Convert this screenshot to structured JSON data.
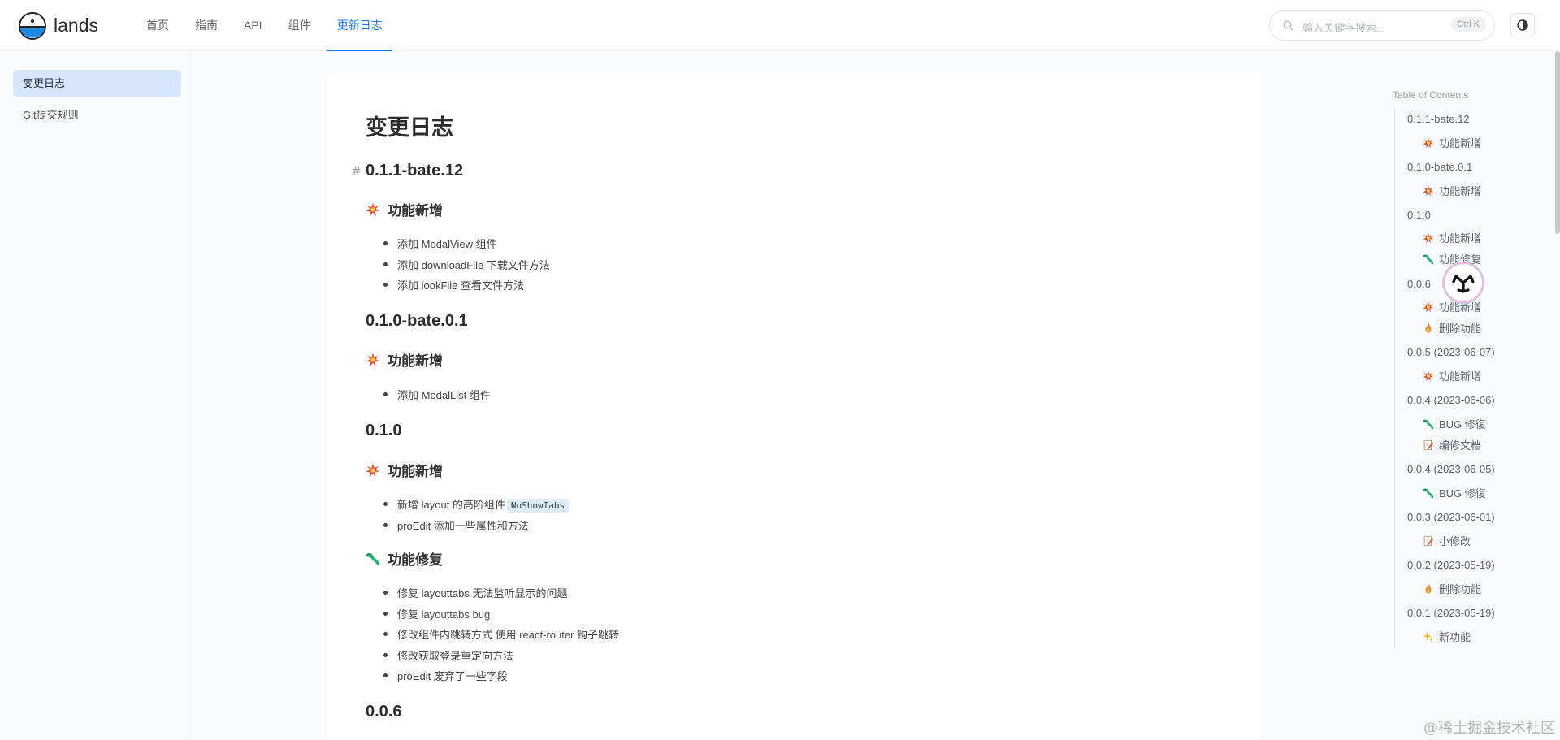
{
  "header": {
    "brand": "lands",
    "nav": [
      "首页",
      "指南",
      "API",
      "组件",
      "更新日志"
    ],
    "active_nav": "更新日志",
    "search": {
      "placeholder": "输入关键字搜索...",
      "shortcut": "Ctrl K"
    },
    "accent": "#1677ff"
  },
  "sidebar": {
    "items": [
      {
        "label": "变更日志",
        "active": true
      },
      {
        "label": "Git提交规则",
        "active": false
      }
    ]
  },
  "doc": {
    "title": "变更日志",
    "anchor": "#",
    "sections": [
      {
        "version": "0.1.1-bate.12",
        "groups": [
          {
            "emoji": "boom",
            "title": "功能新增",
            "items": [
              "添加 ModalView 组件",
              "添加 downloadFile 下载文件方法",
              "添加 lookFile 查看文件方法"
            ]
          }
        ]
      },
      {
        "version": "0.1.0-bate.0.1",
        "groups": [
          {
            "emoji": "boom",
            "title": "功能新增",
            "items": [
              "添加 ModalList 组件"
            ]
          }
        ]
      },
      {
        "version": "0.1.0",
        "groups": [
          {
            "emoji": "boom",
            "title": "功能新增",
            "items": [
              "新增 layout 的高阶组件",
              "proEdit 添加一些属性和方法"
            ],
            "code": "NoShowTabs"
          },
          {
            "emoji": "bug",
            "title": "功能修复",
            "items": [
              "修复 layouttabs 无法监听显示的问题",
              "修复 layouttabs bug",
              "修改组件内跳转方式 使用 react-router 钩子跳转",
              "修改获取登录重定向方法",
              "proEdit 废弃了一些字段"
            ]
          }
        ]
      },
      {
        "version": "0.0.6",
        "groups": []
      }
    ]
  },
  "toc": {
    "title": "Table of Contents",
    "entries": [
      {
        "version": "0.1.1-bate.12",
        "subs": [
          {
            "emoji": "boom",
            "label": "功能新增"
          }
        ]
      },
      {
        "version": "0.1.0-bate.0.1",
        "subs": [
          {
            "emoji": "boom",
            "label": "功能新增"
          }
        ]
      },
      {
        "version": "0.1.0",
        "subs": [
          {
            "emoji": "boom",
            "label": "功能新增"
          },
          {
            "emoji": "bug",
            "label": "功能修复"
          }
        ]
      },
      {
        "version": "0.0.6",
        "subs": [
          {
            "emoji": "boom",
            "label": "功能新增"
          },
          {
            "emoji": "fire",
            "label": "删除功能"
          }
        ]
      },
      {
        "version": "0.0.5 (2023-06-07)",
        "subs": [
          {
            "emoji": "boom",
            "label": "功能新增"
          }
        ]
      },
      {
        "version": "0.0.4 (2023-06-06)",
        "subs": [
          {
            "emoji": "bug",
            "label": "BUG 修復"
          },
          {
            "emoji": "memo",
            "label": "编修文档"
          }
        ]
      },
      {
        "version": "0.0.4 (2023-06-05)",
        "subs": [
          {
            "emoji": "bug",
            "label": "BUG 修復"
          }
        ]
      },
      {
        "version": "0.0.3 (2023-06-01)",
        "subs": [
          {
            "emoji": "memo",
            "label": "小修改"
          }
        ]
      },
      {
        "version": "0.0.2 (2023-05-19)",
        "subs": [
          {
            "emoji": "fire",
            "label": "删除功能"
          }
        ]
      },
      {
        "version": "0.0.1 (2023-05-19)",
        "subs": [
          {
            "emoji": "sparkles",
            "label": "新功能"
          }
        ]
      }
    ]
  },
  "watermark": "@稀土掘金技术社区"
}
